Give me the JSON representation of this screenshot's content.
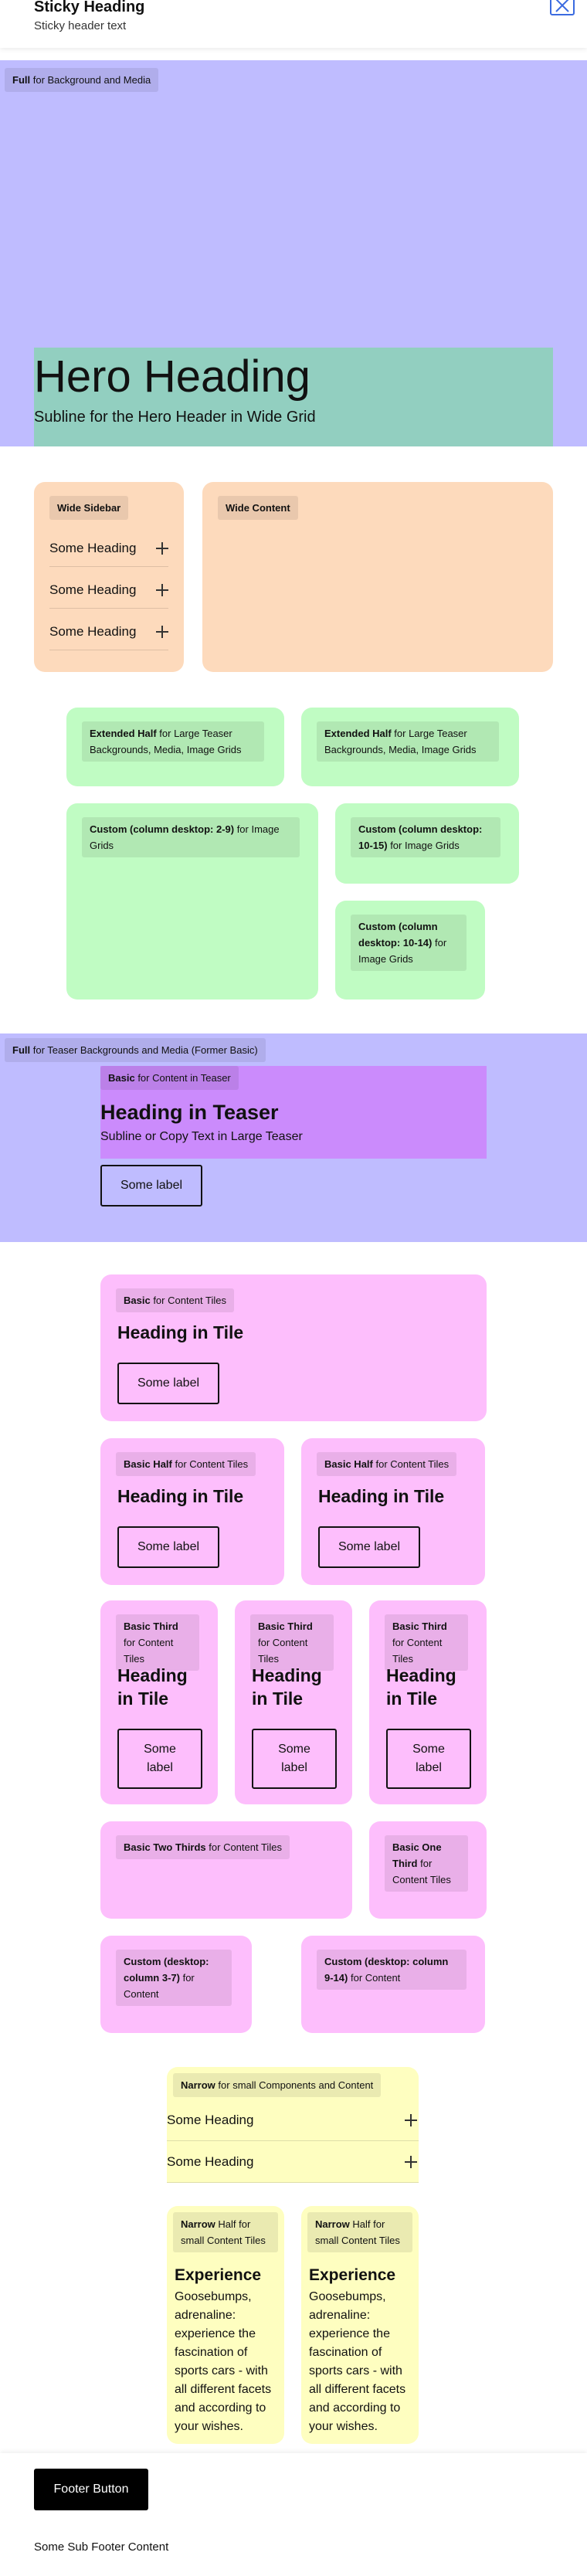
{
  "header": {
    "title": "Sticky Heading",
    "subtitle": "Sticky header text"
  },
  "hero": {
    "tag_bold": "Full",
    "tag_rest": " for Background and Media",
    "heading": "Hero Heading",
    "subline": "Subline for the Hero Header in Wide Grid"
  },
  "wide": {
    "sidebar_tag": "Wide Sidebar",
    "content_tag": "Wide Content",
    "accordion": [
      "Some Heading",
      "Some Heading",
      "Some Heading"
    ]
  },
  "extended": {
    "half_bold": "Extended Half",
    "half_rest": " for Large Teaser Backgrounds, Media, Image Grids",
    "custom1_bold": "Custom (column desktop: 2-9)",
    "custom1_rest": " for Image Grids",
    "custom2_bold": "Custom (column desktop: 10-15)",
    "custom2_rest": " for Image Grids",
    "custom3_bold": "Custom (column desktop: 10-14)",
    "custom3_rest": " for Image Grids"
  },
  "teaser": {
    "full_tag_bold": "Full",
    "full_tag_rest": " for Teaser Backgrounds and Media (Former Basic)",
    "basic_tag_bold": "Basic",
    "basic_tag_rest": " for Content in Teaser",
    "heading": "Heading in Teaser",
    "subline": "Subline or Copy Text in Large Teaser",
    "button": "Some label"
  },
  "tiles": {
    "basic_bold": "Basic",
    "basic_rest": " for Content Tiles",
    "half_bold": "Basic Half",
    "half_rest": " for Content Tiles",
    "third_bold": "Basic Third",
    "third_rest": " for Content Tiles",
    "two_thirds_bold": "Basic Two Thirds",
    "two_thirds_rest": " for Content Tiles",
    "one_third_bold": "Basic One Third",
    "one_third_rest": " for Content Tiles",
    "custom_a_bold": "Custom (desktop: column 3-7)",
    "custom_a_rest": " for Content",
    "custom_b_bold": "Custom (desktop: column 9-14)",
    "custom_b_rest": " for Content",
    "heading": "Heading in Tile",
    "button": "Some label"
  },
  "narrow": {
    "tag_bold": "Narrow",
    "tag_rest": " for small Components and Content",
    "accordion": [
      "Some Heading",
      "Some Heading"
    ],
    "half_bold": "Narrow",
    "half_rest": " Half for small Content Tiles",
    "heading": "Experience",
    "text": "Goosebumps, adrenaline: experience the fascination of sports cars - with all different facets and according to your wishes."
  },
  "footer": {
    "button": "Footer Button",
    "sub": "Some Sub Footer Content"
  },
  "colors": {
    "hero_bg": "#bfbcff",
    "hero_text_bg": "#92cfc0",
    "wide_bg": "#fddabc",
    "extended_bg": "#c0fcc3",
    "basic_teaser_bg": "#cb8bfc",
    "tile_bg": "#fdbefc",
    "narrow_bg": "#fefec0"
  }
}
